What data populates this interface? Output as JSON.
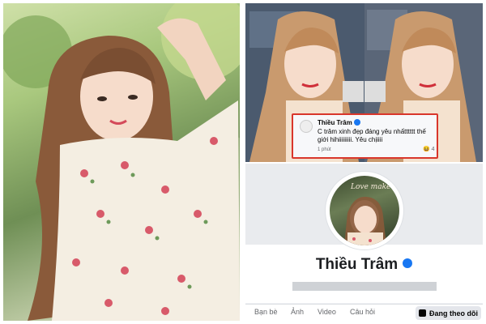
{
  "comment": {
    "author": "Thiều Trâm",
    "text": "C trâm xinh đẹp đáng yêu nhấtttttt thế giới hihiiiiiiiii. Yêu chịiiii",
    "time": "1 phút",
    "reaction_count": "4"
  },
  "profile": {
    "name": "Thiều Trâm",
    "avatar_caption": "Love make",
    "tabs": [
      "Bạn bè",
      "Ảnh",
      "Video",
      "Câu hỏi"
    ],
    "follow_label": "Đang theo dõi"
  },
  "colors": {
    "highlight_border": "#d9362b",
    "verified_blue": "#1877f2"
  }
}
